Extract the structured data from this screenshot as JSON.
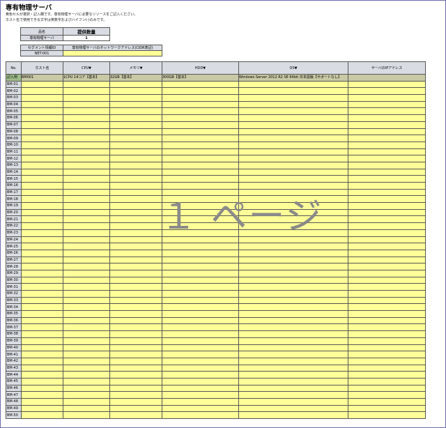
{
  "page": {
    "title": "専有物理サーバ",
    "note1": "黄色セルが選択・記入欄です。専有物理サーバに必要なリソースをご記入ください。",
    "note2": "ホスト名で使用できる文字は英数字およびハイフン(-)のみです。",
    "watermark": "１ ページ"
  },
  "quantity": {
    "header_name": "品名",
    "header_qty": "提供数量",
    "item_name": "専有物理サーバ",
    "item_qty": "1"
  },
  "segment": {
    "header_id": "セグメント情報ID",
    "header_addr": "専有物理サーバのネットワークアドレス(CIDR表記)",
    "id_value": "NET-001",
    "addr_value": ""
  },
  "table": {
    "headers": [
      "No.",
      "ホスト名",
      "CPU▼",
      "メモリ▼",
      "HDD▼",
      "OS▼",
      "サーバのIPアドレス"
    ],
    "example": {
      "label": "記入例",
      "host": "BM001",
      "cpu": "1CPU 14コア【基本】",
      "memory": "32GB【基本】",
      "hdd": "300GB【基本】",
      "os": "Windows Server 2012 R2 SE 64bit 日本語版【サポートなし】",
      "ip": ""
    },
    "rows": [
      "BM-01",
      "BM-02",
      "BM-03",
      "BM-04",
      "BM-05",
      "BM-06",
      "BM-07",
      "BM-08",
      "BM-09",
      "BM-10",
      "BM-11",
      "BM-12",
      "BM-13",
      "BM-14",
      "BM-15",
      "BM-16",
      "BM-17",
      "BM-18",
      "BM-19",
      "BM-20",
      "BM-21",
      "BM-22",
      "BM-23",
      "BM-24",
      "BM-25",
      "BM-26",
      "BM-27",
      "BM-28",
      "BM-29",
      "BM-30",
      "BM-31",
      "BM-32",
      "BM-33",
      "BM-34",
      "BM-35",
      "BM-36",
      "BM-37",
      "BM-38",
      "BM-39",
      "BM-40",
      "BM-41",
      "BM-42",
      "BM-43",
      "BM-44",
      "BM-45",
      "BM-46",
      "BM-47",
      "BM-48",
      "BM-49",
      "BM-50"
    ]
  },
  "colors": {
    "header_gray": "#d9dde3",
    "input_yellow": "#ffff99",
    "example_row": "#c9c9a6",
    "example_label": "#9fbd8a"
  }
}
